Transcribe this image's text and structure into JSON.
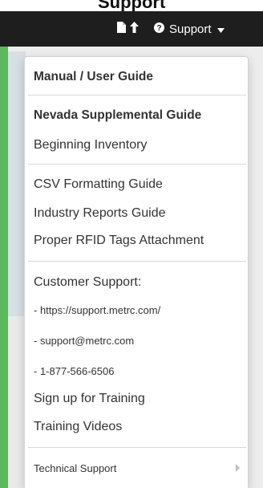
{
  "header": {
    "support_label": "Support",
    "icons": [
      "document-icon",
      "upload-arrow-icon",
      "question-circle-icon",
      "caret-down-icon"
    ]
  },
  "menu": {
    "manual_guide": "Manual / User Guide",
    "nevada_guide": "Nevada Supplemental Guide",
    "beginning_inventory": "Beginning Inventory",
    "csv_guide": "CSV Formatting Guide",
    "industry_reports": "Industry Reports Guide",
    "rfid_tags": "Proper RFID Tags Attachment",
    "customer_support": "Customer Support:",
    "support_url": "- https://support.metrc.com/",
    "support_email": "- support@metrc.com",
    "support_phone": "- 1-877-566-6506",
    "sign_up_training": "Sign up for Training",
    "training_videos": "Training Videos",
    "technical_support": "Technical Support"
  },
  "colors": {
    "navbar": "#1e1e1e",
    "accent_green": "#5cb85c",
    "text": "#333333"
  }
}
